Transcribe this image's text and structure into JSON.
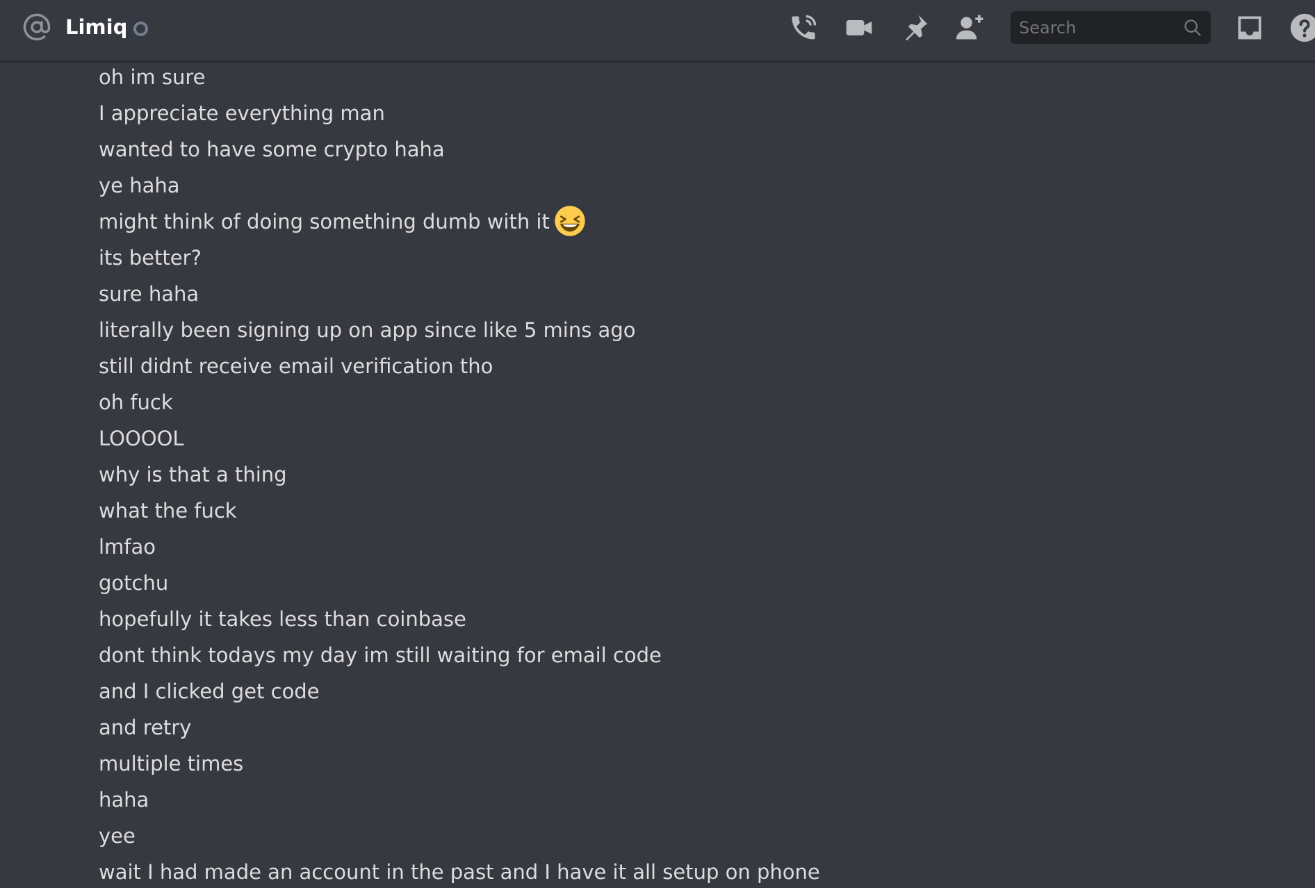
{
  "header": {
    "channel_name": "Limiq",
    "status": "offline",
    "icons": [
      "at-icon",
      "phone-call-icon",
      "video-call-icon",
      "pin-icon",
      "add-friend-icon",
      "inbox-icon",
      "help-icon"
    ]
  },
  "search": {
    "placeholder": "Search",
    "value": ""
  },
  "messages": [
    {
      "text": "oh im sure"
    },
    {
      "text": "I appreciate everything man"
    },
    {
      "text": "wanted to have some crypto haha"
    },
    {
      "text": "ye haha"
    },
    {
      "text": "might think of doing something dumb with it",
      "emoji": "laughing-emoji"
    },
    {
      "text": "its better?"
    },
    {
      "text": "sure haha"
    },
    {
      "text": "literally been signing up on app since like 5 mins ago"
    },
    {
      "text": "still didnt receive email verification tho"
    },
    {
      "text": "oh fuck"
    },
    {
      "text": "LOOOOL"
    },
    {
      "text": "why is that a thing"
    },
    {
      "text": "what the fuck"
    },
    {
      "text": "lmfao"
    },
    {
      "text": "gotchu"
    },
    {
      "text": "hopefully it takes less than coinbase"
    },
    {
      "text": "dont think todays my day im still waiting for email code"
    },
    {
      "text": "and I clicked get code"
    },
    {
      "text": "and retry"
    },
    {
      "text": "multiple times"
    },
    {
      "text": "haha"
    },
    {
      "text": "yee"
    },
    {
      "text": "wait I had made an account in the past and I have it all setup on phone"
    }
  ],
  "colors": {
    "background": "#36393f",
    "text": "#dcddde",
    "icon": "#b9bbbe",
    "search_bg": "#202225",
    "status_offline": "#747f8d"
  }
}
